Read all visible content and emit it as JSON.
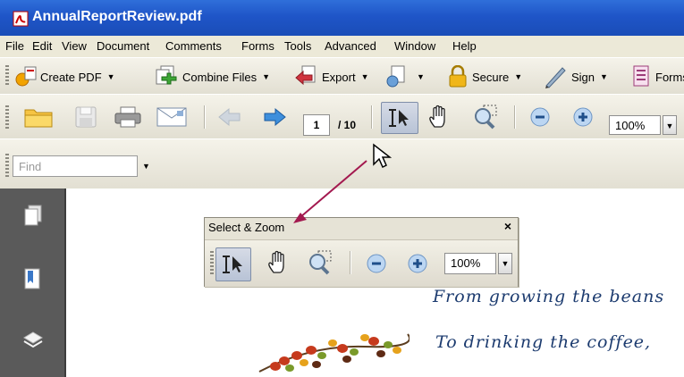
{
  "window": {
    "title": "AnnualReportReview.pdf"
  },
  "menu": {
    "items": [
      "File",
      "Edit",
      "View",
      "Document",
      "Comments",
      "Forms",
      "Tools",
      "Advanced",
      "Window",
      "Help"
    ]
  },
  "task_toolbar": {
    "create_pdf": "Create PDF",
    "combine_files": "Combine Files",
    "export": "Export",
    "secure": "Secure",
    "sign": "Sign",
    "forms": "Forms"
  },
  "page_nav": {
    "current_page": "1",
    "total_pages": "/ 10"
  },
  "zoom": {
    "value": "100%"
  },
  "find": {
    "placeholder": "Find"
  },
  "floating_toolbar": {
    "title": "Select & Zoom",
    "close": "×",
    "zoom_value": "100%"
  },
  "document": {
    "line1": "From growing the beans",
    "line2": "To drinking the coffee,"
  },
  "colors": {
    "titlebar": "#2160cf",
    "annotation_arrow": "#a3194f",
    "doc_text": "#1c3b6f"
  }
}
